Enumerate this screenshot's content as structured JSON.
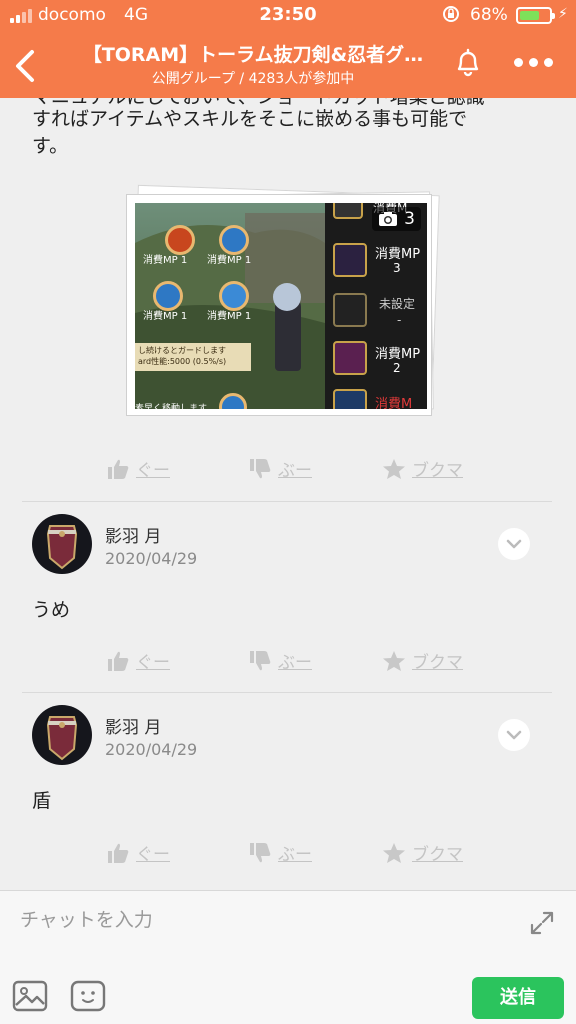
{
  "status_bar": {
    "carrier": "docomo",
    "network": "4G",
    "time": "23:50",
    "battery_percent": "68%",
    "battery_level": 0.68
  },
  "header": {
    "title": "【TORAM】トーラム抜刀剣&忍者グ…",
    "subtitle": "公開グループ / 4283人が参加中"
  },
  "post": {
    "text_lines": [
      "すればアイテムやスキルをそこに嵌める事も可能で",
      "す。"
    ],
    "photo": {
      "count": "3",
      "skill_labels": [
        "消費MP 1",
        "消費MP 1",
        "消費MP 1",
        "消費MP 1"
      ],
      "tooltip_lines": [
        "し続けるとガードします",
        "ard性能:5000 (0.5%/s)"
      ],
      "tooltip2": "素早く移動します",
      "side_slots": [
        {
          "label": "消費M",
          "value": ""
        },
        {
          "label": "消費MP",
          "value": "3"
        },
        {
          "label": "未設定",
          "value": "-"
        },
        {
          "label": "消費MP",
          "value": "2"
        },
        {
          "label": "消費M",
          "value": ""
        }
      ]
    }
  },
  "reaction_labels": {
    "good": "ぐー",
    "boo": "ぶー",
    "bookmark": "ブクマ"
  },
  "comments": [
    {
      "user": "影羽 月",
      "date": "2020/04/29",
      "text": "うめ"
    },
    {
      "user": "影羽 月",
      "date": "2020/04/29",
      "text": "盾"
    }
  ],
  "composer": {
    "placeholder": "チャットを入力",
    "send_label": "送信"
  },
  "colors": {
    "header": "#f57b4a",
    "send": "#2bc45d",
    "battery": "#7ee05a"
  }
}
